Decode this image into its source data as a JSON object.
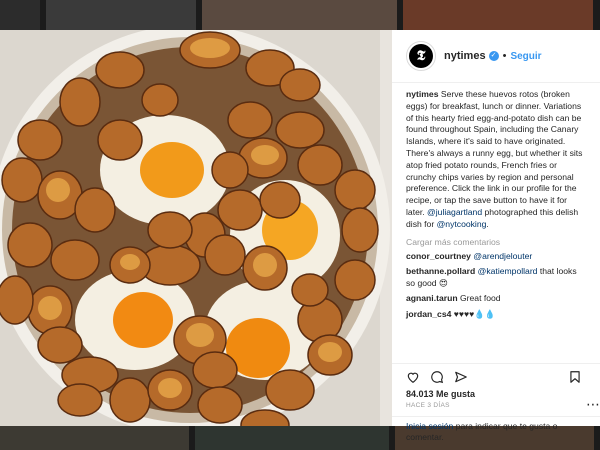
{
  "account": {
    "username": "nytimes",
    "follow_label": "Seguir",
    "separator": "•"
  },
  "caption": {
    "username": "nytimes",
    "text_part1": " Serve these huevos rotos (broken eggs) for breakfast, lunch or dinner. Variations of this hearty fried egg-and-potato dish can be found throughout Spain, including the Canary Islands, where it's said to have originated. There's always a runny egg, but whether it sits atop fried potato rounds, French fries or crunchy chips varies by region and personal preference. Click the link in our profile for the recipe, or tap the save button to have it for later. ",
    "mention1": "@juliagartland",
    "text_part2": " photographed this delish dish for ",
    "mention2": "@nytcooking",
    "text_part3": "."
  },
  "load_more": "Cargar más comentarios",
  "comments": [
    {
      "user": "conor_courtney",
      "text": "",
      "mention": "@arendjelouter"
    },
    {
      "user": "bethanne.pollard",
      "text": " that looks so good 😍",
      "mention": "@katiempollard"
    },
    {
      "user": "agnani.tarun",
      "text": " Great food",
      "mention": ""
    },
    {
      "user": "jordan_cs4",
      "text": " ♥♥♥♥💧💧",
      "mention": ""
    }
  ],
  "likes": "84.013 Me gusta",
  "timestamp": "HACE 3 DÍAS",
  "login_prompt": {
    "link": "Inicia sesión",
    "text": " para indicar que te gusta o comentar."
  },
  "icons": [
    "heart-icon",
    "comment-icon",
    "share-icon",
    "bookmark-icon",
    "more-icon"
  ],
  "colors": {
    "link": "#003569",
    "follow": "#3897f0",
    "verified": "#3897f0"
  }
}
